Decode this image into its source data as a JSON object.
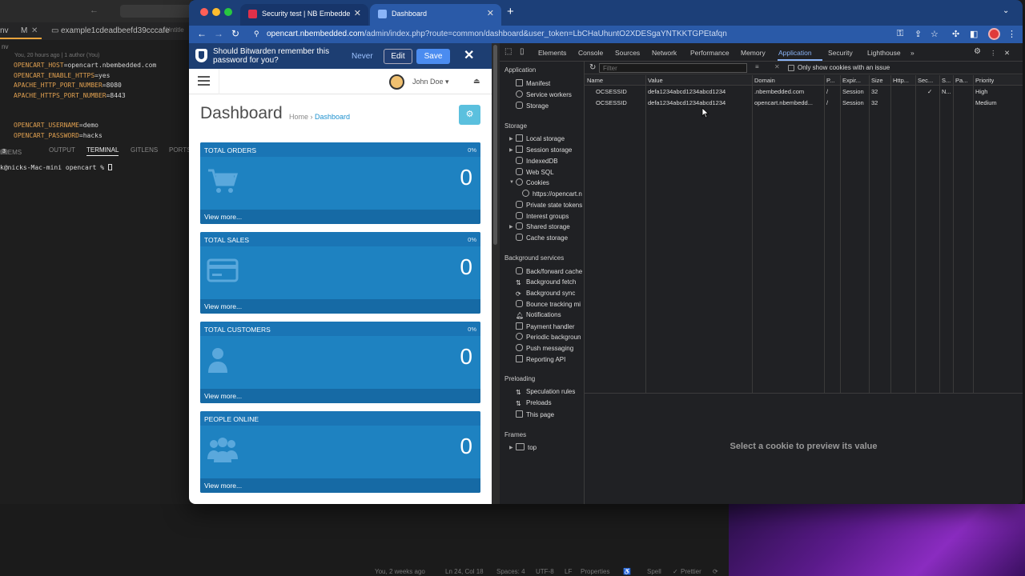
{
  "vscode": {
    "tabs": [
      "nv",
      "M",
      "example1cdeadbeefd39cccafe",
      "Untitle"
    ],
    "blame": "You, 20 hours ago | 1 author (You)",
    "code_lines": [
      {
        "key": "OPENCART_HOST",
        "value": "opencart.nbembedded.com"
      },
      {
        "key": "OPENCART_ENABLE_HTTPS",
        "value": "yes"
      },
      {
        "key": "APACHE_HTTP_PORT_NUMBER",
        "value": "8080"
      },
      {
        "key": "APACHE_HTTPS_PORT_NUMBER",
        "value": "8443"
      },
      {
        "key": "",
        "value": ""
      },
      {
        "key": "",
        "value": ""
      },
      {
        "key": "OPENCART_USERNAME",
        "value": "demo"
      },
      {
        "key": "OPENCART_PASSWORD",
        "value": "hacks"
      }
    ],
    "panel_tabs": {
      "problems": "BLEMS",
      "problems_count": "3",
      "output": "OUTPUT",
      "terminal": "TERMINAL",
      "gitlens": "GITLENS",
      "ports": "PORTS"
    },
    "terminal_prompt": "k@nicks-Mac-mini opencart % ",
    "status": {
      "blame": "You, 2 weeks ago",
      "position": "Ln 24, Col 18",
      "spaces": "Spaces: 4",
      "encoding": "UTF-8",
      "eol": "LF",
      "properties": "Properties",
      "spell": "Spell",
      "prettier": "Prettier"
    }
  },
  "browser": {
    "tabs": [
      {
        "title": "Security test | NB Embedded"
      },
      {
        "title": "Dashboard"
      }
    ],
    "url_host": "opencart.nbembedded.com",
    "url_path": "/admin/index.php?route=common/dashboard&user_token=LbCHaUhuntO2XDESgaYNTKKTGPEtafqn"
  },
  "bitwarden": {
    "message": "Should Bitwarden remember this password for you?",
    "never": "Never",
    "edit": "Edit",
    "save": "Save"
  },
  "opencart": {
    "user": "John Doe",
    "title": "Dashboard",
    "breadcrumb_home": "Home",
    "breadcrumb_current": "Dashboard",
    "tiles": [
      {
        "label": "TOTAL ORDERS",
        "percent": "0%",
        "value": "0",
        "more": "View more..."
      },
      {
        "label": "TOTAL SALES",
        "percent": "0%",
        "value": "0",
        "more": "View more..."
      },
      {
        "label": "TOTAL CUSTOMERS",
        "percent": "0%",
        "value": "0",
        "more": "View more..."
      },
      {
        "label": "PEOPLE ONLINE",
        "percent": "",
        "value": "0",
        "more": "View more..."
      }
    ]
  },
  "devtools": {
    "tabs": [
      "Elements",
      "Console",
      "Sources",
      "Network",
      "Performance",
      "Memory",
      "Application",
      "Security",
      "Lighthouse"
    ],
    "active_tab": "Application",
    "sidebar": {
      "application_header": "Application",
      "application_items": [
        "Manifest",
        "Service workers",
        "Storage"
      ],
      "storage_header": "Storage",
      "storage_items": [
        "Local storage",
        "Session storage",
        "IndexedDB",
        "Web SQL",
        "Cookies",
        "https://opencart.n",
        "Private state tokens",
        "Interest groups",
        "Shared storage",
        "Cache storage"
      ],
      "background_header": "Background services",
      "background_items": [
        "Back/forward cache",
        "Background fetch",
        "Background sync",
        "Bounce tracking mi",
        "Notifications",
        "Payment handler",
        "Periodic backgroun",
        "Push messaging",
        "Reporting API"
      ],
      "preloading_header": "Preloading",
      "preloading_items": [
        "Speculation rules",
        "Preloads",
        "This page"
      ],
      "frames_header": "Frames",
      "frames_items": [
        "top"
      ]
    },
    "filter_placeholder": "Filter",
    "only_issues_label": "Only show cookies with an issue",
    "columns": [
      "Name",
      "Value",
      "Domain",
      "P...",
      "Expir...",
      "Size",
      "Http...",
      "Sec...",
      "S...",
      "Pa...",
      "Priority"
    ],
    "cookies": [
      {
        "name": "OCSESSID",
        "value": "defa1234abcd1234abcd1234",
        "domain": ".nbembedded.com",
        "path": "/",
        "expires": "Session",
        "size": "32",
        "http": "",
        "secure": "✓",
        "samesite": "N...",
        "partition": "",
        "priority": "High"
      },
      {
        "name": "OCSESSID",
        "value": "defa1234abcd1234abcd1234",
        "domain": "opencart.nbembedd...",
        "path": "/",
        "expires": "Session",
        "size": "32",
        "http": "",
        "secure": "",
        "samesite": "",
        "partition": "",
        "priority": "Medium"
      }
    ],
    "preview_message": "Select a cookie to preview its value"
  }
}
